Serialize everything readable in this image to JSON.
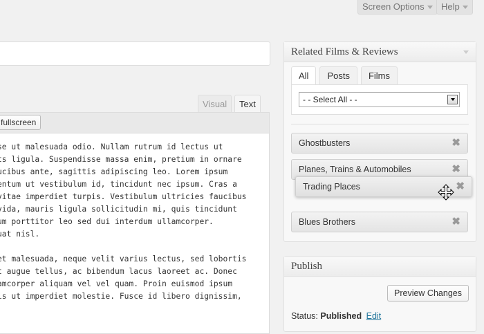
{
  "screen_meta": {
    "screen_options": "Screen Options",
    "help": "Help"
  },
  "editor": {
    "tab_visual": "Visual",
    "tab_text": "Text",
    "fullscreen_label": "fullscreen",
    "lines": [
      "se ut malesuada odio. Nullam rutrum id lectus ut",
      "ts ligula. Suspendisse massa enim, pretium in ornare",
      "ucibus ante, sagittis adipiscing leo. Lorem ipsum",
      "entum ut vestibulum id, tincidunt nec ipsum. Cras a",
      "vitae imperdiet turpis. Vestibulum ultricies faucibus",
      "vida, mauris ligula sollicitudin mi, quis tincidunt",
      "um porttitor leo sed dui interdum ullamcorper.",
      "uat nisl.",
      "",
      "et malesuada, neque velit varius lectus, sed lobortis",
      "t augue tellus, ac bibendum lacus laoreet ac. Donec",
      "amcorper aliquam vel vel quam. Proin euismod ipsum",
      "is ut imperdiet molestie. Fusce id libero dignissim,"
    ]
  },
  "related": {
    "title": "Related Films & Reviews",
    "tabs": [
      {
        "label": "All",
        "active": true
      },
      {
        "label": "Posts",
        "active": false
      },
      {
        "label": "Films",
        "active": false
      }
    ],
    "select_value": "- - Select All - -",
    "items": [
      {
        "label": "Ghostbusters"
      },
      {
        "label": "Planes, Trains & Automobiles"
      },
      {
        "label": "Trading Places"
      },
      {
        "label": "Blues Brothers"
      }
    ],
    "remove_glyph": "✖"
  },
  "publish": {
    "title": "Publish",
    "preview_button": "Preview Changes",
    "status_label": "Status:",
    "status_value": "Published",
    "edit_link": "Edit"
  }
}
